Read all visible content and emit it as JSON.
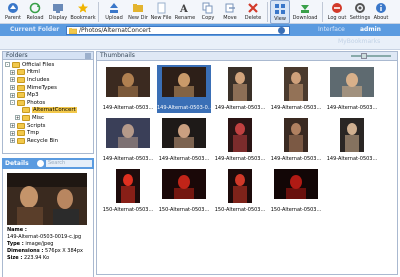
{
  "toolbar": [
    {
      "label": "Parent",
      "icon": "parent-arrow-icon",
      "color": "#3a77c9"
    },
    {
      "label": "Reload",
      "icon": "reload-icon",
      "color": "#3aa04a"
    },
    {
      "label": "Display",
      "icon": "display-icon",
      "color": "#6a8ab8"
    },
    {
      "label": "Bookmark",
      "icon": "bookmark-star-icon",
      "color": "#f0b400"
    },
    {
      "label": "Upload",
      "icon": "upload-icon",
      "color": "#3a77c9"
    },
    {
      "label": "New Dir",
      "icon": "new-folder-icon",
      "color": "#e3b42f"
    },
    {
      "label": "New File",
      "icon": "new-file-icon",
      "color": "#9ab0cc"
    },
    {
      "label": "Rename",
      "icon": "rename-icon",
      "color": "#444"
    },
    {
      "label": "Copy",
      "icon": "copy-icon",
      "color": "#7b95bb"
    },
    {
      "label": "Move",
      "icon": "move-icon",
      "color": "#7b95bb"
    },
    {
      "label": "Delete",
      "icon": "delete-icon",
      "color": "#d23a2a"
    },
    {
      "label": "View",
      "icon": "view-icon",
      "color": "#3a77c9",
      "active": true
    },
    {
      "label": "Download",
      "icon": "download-icon",
      "color": "#3aa04a"
    },
    {
      "label": "Log out",
      "icon": "logout-icon",
      "color": "#d23a2a"
    },
    {
      "label": "Settings",
      "icon": "settings-icon",
      "color": "#555"
    },
    {
      "label": "About",
      "icon": "about-icon",
      "color": "#3a77c9"
    }
  ],
  "folderbar": {
    "current_label": "Current Folder",
    "path": "/Photos/AlternatConcert",
    "interface_label": "Interface",
    "user": "admin"
  },
  "bookmarks_label": "MyBookmarks",
  "folders": {
    "title": "Folders",
    "items": [
      {
        "label": "Official Files",
        "expand": "-",
        "indent": 0
      },
      {
        "label": "Html",
        "expand": "+",
        "indent": 1
      },
      {
        "label": "Includes",
        "expand": "+",
        "indent": 1
      },
      {
        "label": "MimeTypes",
        "expand": "+",
        "indent": 1
      },
      {
        "label": "Mp3",
        "expand": "+",
        "indent": 1
      },
      {
        "label": "Photos",
        "expand": "-",
        "indent": 1
      },
      {
        "label": "AlternatConcert",
        "expand": "",
        "indent": 2,
        "selected": true
      },
      {
        "label": "Misc",
        "expand": "+",
        "indent": 2
      },
      {
        "label": "Scripts",
        "expand": "+",
        "indent": 1
      },
      {
        "label": "Tmp",
        "expand": "+",
        "indent": 1
      },
      {
        "label": "Recycle Bin",
        "expand": "+",
        "indent": 1
      }
    ]
  },
  "details": {
    "title": "Details",
    "search_placeholder": "Search",
    "name_label": "Name :",
    "name": "149-Alternat-0503-0019-c.jpg",
    "type_label": "Type :",
    "type": "image/jpeg",
    "dimensions_label": "Dimensions :",
    "dimensions": "576px X 384px",
    "size_label": "Size :",
    "size": "223.94 Ko"
  },
  "thumbnails": {
    "title": "Thumbnails",
    "items": [
      {
        "caption": "149-Alternat-0503...",
        "shape": "land",
        "bg": "#3b2a20",
        "fg": "#b08050"
      },
      {
        "caption": "149-Alternat-0503-0...",
        "shape": "land",
        "bg": "#2d1f18",
        "fg": "#c99a6a",
        "selected": true
      },
      {
        "caption": "149-Alternat-0503...",
        "shape": "port",
        "bg": "#3a3028",
        "fg": "#d2a47c"
      },
      {
        "caption": "149-Alternat-0503...",
        "shape": "port",
        "bg": "#4a3a2e",
        "fg": "#cfa07a"
      },
      {
        "caption": "149-Alternat-0503...",
        "shape": "land",
        "bg": "#5e6a70",
        "fg": "#d8b08a"
      },
      {
        "caption": "149-Alternat-0503...",
        "shape": "land",
        "bg": "#3a3f58",
        "fg": "#b59a8a"
      },
      {
        "caption": "149-Alternat-0503...",
        "shape": "land",
        "bg": "#1e1a18",
        "fg": "#caa080"
      },
      {
        "caption": "149-Alternat-0503...",
        "shape": "port",
        "bg": "#2a1414",
        "fg": "#c04040"
      },
      {
        "caption": "149-Alternat-0503...",
        "shape": "port",
        "bg": "#3a2a22",
        "fg": "#b08060"
      },
      {
        "caption": "149-Alternat-0503...",
        "shape": "port",
        "bg": "#2a2624",
        "fg": "#d0b090"
      },
      {
        "caption": "150-Alternat-0503...",
        "shape": "port",
        "bg": "#1e0c0c",
        "fg": "#e03020"
      },
      {
        "caption": "150-Alternat-0503...",
        "shape": "land",
        "bg": "#1a0808",
        "fg": "#c02418"
      },
      {
        "caption": "150-Alternat-0503...",
        "shape": "port",
        "bg": "#1c0a0a",
        "fg": "#d03828"
      },
      {
        "caption": "150-Alternat-0503...",
        "shape": "land",
        "bg": "#120606",
        "fg": "#b01a14"
      }
    ]
  }
}
